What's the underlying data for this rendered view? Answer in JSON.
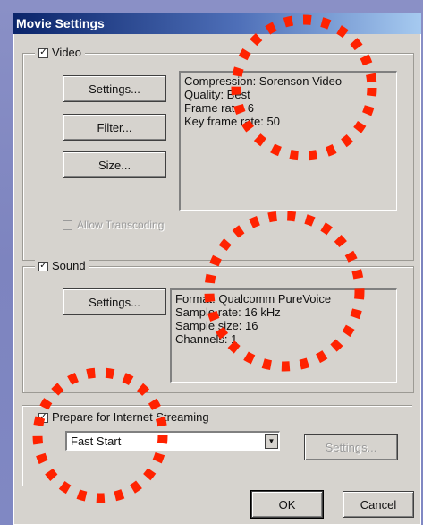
{
  "window": {
    "title": "Movie Settings"
  },
  "video": {
    "label": "Video",
    "checked": true,
    "buttons": {
      "settings": "Settings...",
      "filter": "Filter...",
      "size": "Size..."
    },
    "info": [
      "Compression: Sorenson Video",
      "Quality: Best",
      "Frame rate: 6",
      "Key frame rate: 50"
    ],
    "allow_transcoding": "Allow Transcoding"
  },
  "sound": {
    "label": "Sound",
    "checked": true,
    "buttons": {
      "settings": "Settings..."
    },
    "info": [
      "Format: Qualcomm PureVoice",
      "Sample rate: 16 kHz",
      "Sample size: 16",
      "Channels: 1"
    ]
  },
  "streaming": {
    "label": "Prepare for Internet Streaming",
    "checked": true,
    "selected": "Fast Start",
    "settings_button": "Settings..."
  },
  "footer": {
    "ok": "OK",
    "cancel": "Cancel"
  },
  "colors": {
    "annotation": "#ff2200",
    "background": "#8088c3",
    "dialog": "#d6d3ce"
  }
}
